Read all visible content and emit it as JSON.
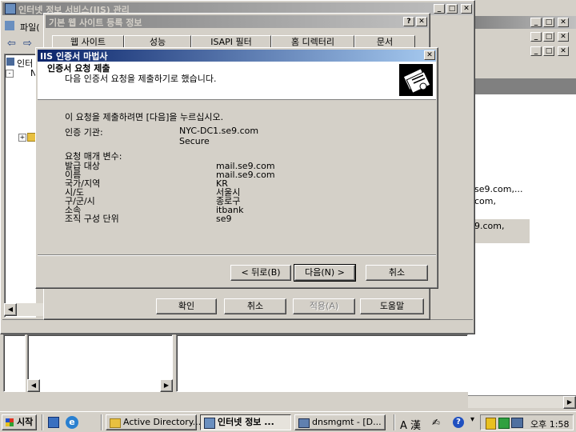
{
  "iis_window": {
    "title": "인터넷 정보 서비스(IIS) 관리",
    "menu_partial": "파일(",
    "tree_root_partial": "인터",
    "tree_node_partial": "N"
  },
  "background_window": {
    "list_items": [
      "se9.com,...",
      "com,",
      "9.com,"
    ]
  },
  "props_dialog": {
    "title": "기본 웹 사이트 등록 정보",
    "tabs": [
      "웹 사이트",
      "성능",
      "ISAPI 필터",
      "홈 디렉터리",
      "문서"
    ],
    "buttons": {
      "ok": "확인",
      "cancel": "취소",
      "apply": "적용(A)",
      "help": "도움말"
    }
  },
  "wizard": {
    "title": "IIS 인증서 마법사",
    "header_title": "인증서 요청 제출",
    "header_subtitle": "다음 인증서 요청을 제출하기로 했습니다.",
    "instruction": "이 요청을 제출하려면 [다음]을 누르십시오.",
    "authority_label": "인증 기관:",
    "authority_value": "NYC-DC1.se9.com",
    "authority_value2": "Secure",
    "params_label": "요청 매개 변수:",
    "params": [
      {
        "label": "발급 대상",
        "value": "mail.se9.com"
      },
      {
        "label": "이름",
        "value": "mail.se9.com"
      },
      {
        "label": "국가/지역",
        "value": "KR"
      },
      {
        "label": "시/도",
        "value": "서울시"
      },
      {
        "label": "구/군/시",
        "value": "종로구"
      },
      {
        "label": "소속",
        "value": "itbank"
      },
      {
        "label": "조직 구성 단위",
        "value": "se9"
      }
    ],
    "buttons": {
      "back": "< 뒤로(B)",
      "next": "다음(N) >",
      "cancel": "취소"
    }
  },
  "taskbar": {
    "start": "시작",
    "tasks": [
      "Active Directory...",
      "인터넷 정보 ...",
      "dnsmgmt - [D..."
    ],
    "lang_indicator": "A 漢",
    "clock": "오후 1:58"
  },
  "colors": {
    "desktop_gray": "#d4d0c8",
    "active_title": "#0a246a",
    "inactive_title": "#808080"
  }
}
